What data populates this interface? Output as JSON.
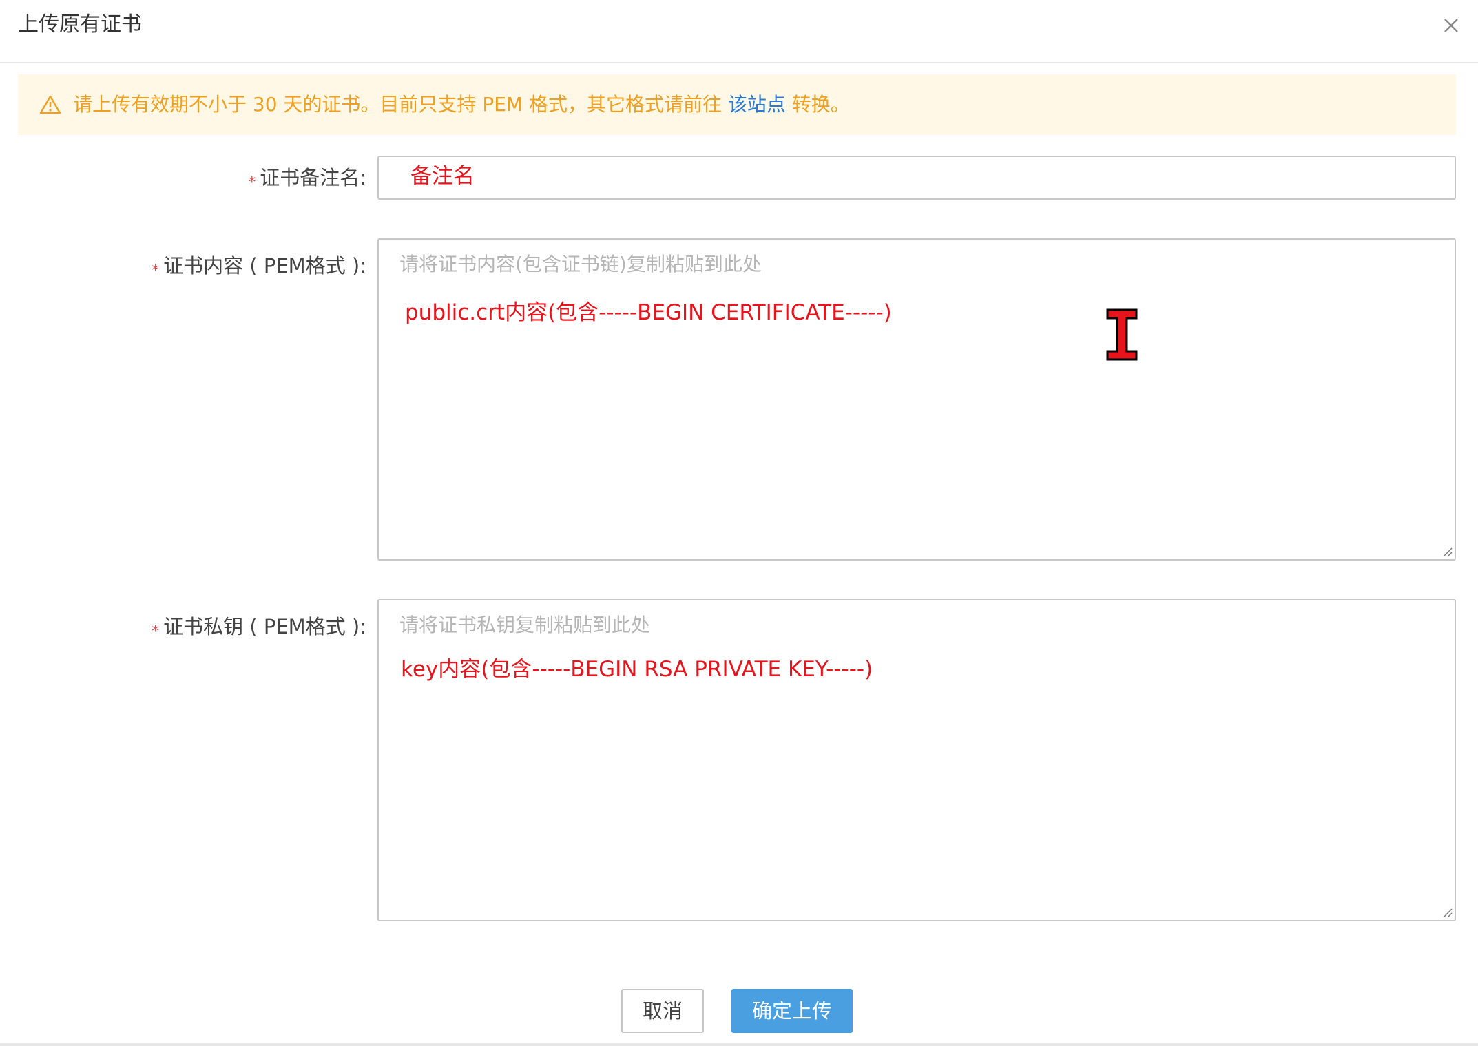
{
  "dialog": {
    "title": "上传原有证书",
    "close_icon": "close-icon"
  },
  "notice": {
    "icon": "warning-icon",
    "text_before": "请上传有效期不小于 30 天的证书。目前只支持 PEM 格式，其它格式请前往 ",
    "link_text": "该站点",
    "text_after": " 转换。",
    "color": "#f0a020",
    "link_color": "#2b7bd6",
    "background": "#fff8e6"
  },
  "form": {
    "required_mark": "*",
    "name_field": {
      "label": "证书备注名:",
      "annotation": "备注名"
    },
    "cert_field": {
      "label": "证书内容 ( PEM格式 ):",
      "placeholder": "请将证书内容(包含证书链)复制粘贴到此处",
      "annotation": "public.crt内容(包含-----BEGIN CERTIFICATE-----)"
    },
    "key_field": {
      "label": "证书私钥 ( PEM格式 ):",
      "placeholder": "请将证书私钥复制粘贴到此处",
      "annotation": "key内容(包含-----BEGIN RSA PRIVATE KEY-----)"
    },
    "annotation_color": "#e8141c"
  },
  "footer": {
    "cancel_label": "取消",
    "submit_label": "确定上传",
    "submit_color": "#4a9fe0"
  },
  "overlay": {
    "cursor_icon": "text-cursor-icon"
  }
}
